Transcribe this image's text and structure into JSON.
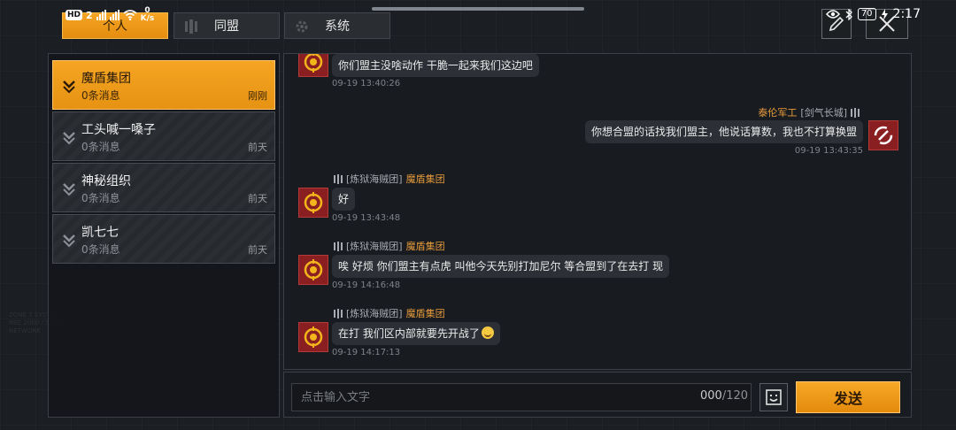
{
  "status_bar": {
    "hd": "HD",
    "sim": "2",
    "speed": "0",
    "speed_unit": "K/s",
    "battery": "70",
    "time": "2:17"
  },
  "tabs": [
    {
      "label": "个人",
      "active": true
    },
    {
      "label": "同盟",
      "active": false
    },
    {
      "label": "系统",
      "active": false
    }
  ],
  "conversations": [
    {
      "name": "魔盾集团",
      "count": "0条消息",
      "time": "刚刚",
      "active": true
    },
    {
      "name": "工头喊一嗓子",
      "count": "0条消息",
      "time": "前天",
      "active": false
    },
    {
      "name": "神秘组织",
      "count": "0条消息",
      "time": "前天",
      "active": false
    },
    {
      "name": "凯七七",
      "count": "0条消息",
      "time": "前天",
      "active": false
    }
  ],
  "messages": [
    {
      "side": "left",
      "sender_guild": "",
      "sender_name": "",
      "text": "你们盟主没啥动作 干脆一起来我们这边吧",
      "time": "09-19 13:40:26"
    },
    {
      "side": "right",
      "sender_name": "泰伦军工",
      "sender_guild": "[剑气长城]",
      "text": "你想合盟的话找我们盟主，他说话算数，我也不打算换盟",
      "time": "09-19 13:43:35"
    },
    {
      "side": "left",
      "sender_guild": "[炼狱海贼团]",
      "sender_name": "魔盾集团",
      "text": "好",
      "time": "09-19 13:43:48"
    },
    {
      "side": "left",
      "sender_guild": "[炼狱海贼团]",
      "sender_name": "魔盾集团",
      "text": "唉 好烦 你们盟主有点虎 叫他今天先别打加尼尔 等合盟到了在去打 现",
      "time": "09-19 14:16:48"
    },
    {
      "side": "left",
      "sender_guild": "[炼狱海贼团]",
      "sender_name": "魔盾集团",
      "text": "在打 我们区内部就要先开战了",
      "time": "09-19 14:17:13"
    }
  ],
  "input": {
    "placeholder": "点击输入文字",
    "value": "",
    "count": "000",
    "max": "/120"
  },
  "send_label": "发送",
  "colors": {
    "accent": "#f29c1f",
    "guild_name": "#e59a3a",
    "avatar_red": "#8a1f21"
  }
}
